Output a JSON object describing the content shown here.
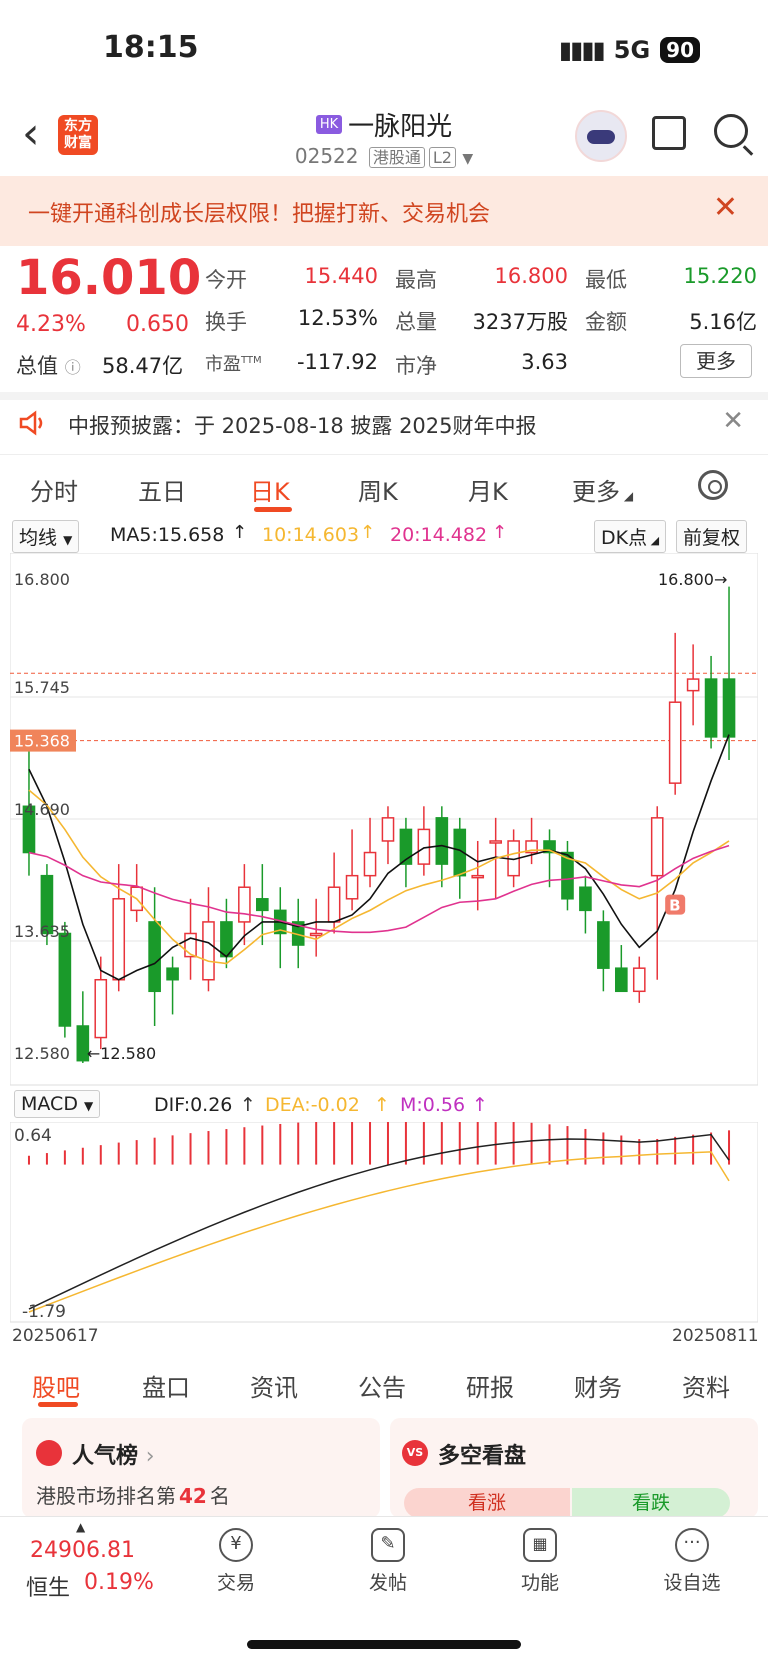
{
  "status_bar": {
    "time": "18:15",
    "network": "5G",
    "battery": "90"
  },
  "header": {
    "logo_text": "东方\n财富",
    "market_tag": "HK",
    "stock_name": "一脉阳光",
    "stock_code": "02522",
    "tag1": "港股通",
    "tag2": "L2"
  },
  "banner": {
    "text": "一键开通科创成长层权限！把握打新、交易机会"
  },
  "quote": {
    "price": "16.010",
    "change_pct": "4.23%",
    "change": "0.650",
    "mcap_label": "总值",
    "mcap": "58.47亿",
    "open_label": "今开",
    "open": "15.440",
    "high_label": "最高",
    "high": "16.800",
    "low_label": "最低",
    "low": "15.220",
    "turnover_label": "换手",
    "turnover": "12.53%",
    "volume_label": "总量",
    "volume": "3237万股",
    "amount_label": "金额",
    "amount": "5.16亿",
    "pe_label": "市盈",
    "pe_sup": "TTM",
    "pe": "-117.92",
    "pb_label": "市净",
    "pb": "3.63",
    "more_label": "更多"
  },
  "notice": {
    "text": "中报预披露：于 2025-08-18 披露 2025财年中报"
  },
  "chart_tabs": [
    "分时",
    "五日",
    "日K",
    "周K",
    "月K",
    "更多"
  ],
  "chart_tab_active": "日K",
  "ma_bar": {
    "selector": "均线",
    "ma5": "MA5:15.658",
    "ma10": "10:14.603",
    "ma20": "20:14.482",
    "dk_label": "DK点",
    "fq_label": "前复权"
  },
  "macd_bar": {
    "selector": "MACD",
    "dif": "DIF:0.26",
    "dea": "DEA:-0.02",
    "m": "M:0.56"
  },
  "colors": {
    "up": "#e8333a",
    "down": "#1a9a2a",
    "ma5": "#111111",
    "ma10": "#f5b731",
    "ma20": "#e0338f",
    "accent": "#f04a23"
  },
  "chart_data": [
    {
      "type": "candlestick",
      "title": "日K",
      "y_ticks": [
        "16.800",
        "15.745",
        "14.690",
        "13.635",
        "12.580"
      ],
      "ylim": [
        12.58,
        16.8
      ],
      "current_price_label": "15.368",
      "max_label": "16.800",
      "min_label": "12.580",
      "marker": "B",
      "start_date": "20250617",
      "end_date": "20250811",
      "candles": [
        [
          14.8,
          14.4,
          15.3,
          14.2
        ],
        [
          14.2,
          13.7,
          14.3,
          13.6
        ],
        [
          13.7,
          12.9,
          13.8,
          12.8
        ],
        [
          12.9,
          12.6,
          13.2,
          12.58
        ],
        [
          12.8,
          13.3,
          13.5,
          12.7
        ],
        [
          13.3,
          14.0,
          14.3,
          13.2
        ],
        [
          13.9,
          14.1,
          14.3,
          13.8
        ],
        [
          13.8,
          13.2,
          14.1,
          12.9
        ],
        [
          13.4,
          13.3,
          13.5,
          13.0
        ],
        [
          13.5,
          13.7,
          14.0,
          13.3
        ],
        [
          13.3,
          13.8,
          14.1,
          13.2
        ],
        [
          13.8,
          13.5,
          14.0,
          13.4
        ],
        [
          13.8,
          14.1,
          14.3,
          13.6
        ],
        [
          14.0,
          13.9,
          14.3,
          13.6
        ],
        [
          13.9,
          13.7,
          14.1,
          13.4
        ],
        [
          13.8,
          13.6,
          14.0,
          13.4
        ],
        [
          13.7,
          13.7,
          14.0,
          13.5
        ],
        [
          13.8,
          14.1,
          14.4,
          13.7
        ],
        [
          14.0,
          14.2,
          14.6,
          13.9
        ],
        [
          14.2,
          14.4,
          14.7,
          14.1
        ],
        [
          14.5,
          14.7,
          14.8,
          14.3
        ],
        [
          14.6,
          14.3,
          14.7,
          14.1
        ],
        [
          14.3,
          14.6,
          14.8,
          14.2
        ],
        [
          14.7,
          14.3,
          14.8,
          14.1
        ],
        [
          14.6,
          14.2,
          14.7,
          14.0
        ],
        [
          14.2,
          14.2,
          14.5,
          13.9
        ],
        [
          14.5,
          14.5,
          14.7,
          14.0
        ],
        [
          14.2,
          14.5,
          14.6,
          14.1
        ],
        [
          14.4,
          14.5,
          14.7,
          14.3
        ],
        [
          14.5,
          14.4,
          14.6,
          14.1
        ],
        [
          14.4,
          14.0,
          14.5,
          13.9
        ],
        [
          14.1,
          13.9,
          14.2,
          13.7
        ],
        [
          13.8,
          13.4,
          13.9,
          13.2
        ],
        [
          13.4,
          13.2,
          13.6,
          13.2
        ],
        [
          13.2,
          13.4,
          13.5,
          13.1
        ],
        [
          14.2,
          14.7,
          14.8,
          13.3
        ],
        [
          15.0,
          15.7,
          16.3,
          14.9
        ],
        [
          15.8,
          15.9,
          16.2,
          15.5
        ],
        [
          15.9,
          15.4,
          16.1,
          15.3
        ],
        [
          15.9,
          15.4,
          16.7,
          15.2
        ]
      ],
      "ma5_end": 15.658,
      "ma10_end": 14.603,
      "ma20_end": 14.482
    },
    {
      "type": "bar",
      "title": "MACD",
      "y_ticks": [
        "0.64",
        "-1.79"
      ],
      "ylim": [
        -1.79,
        0.64
      ],
      "dif": 0.26,
      "dea": -0.02,
      "m": 0.56
    }
  ],
  "section_tabs": [
    "股吧",
    "盘口",
    "资讯",
    "公告",
    "研报",
    "财务",
    "资料"
  ],
  "section_tab_active": "股吧",
  "cards": {
    "popularity_title": "人气榜",
    "popularity_sub_prefix": "港股市场排名第",
    "popularity_rank": "42",
    "popularity_sub_suffix": "名",
    "vs_title": "多空看盘",
    "vs_up": "看涨",
    "vs_down": "看跌"
  },
  "bottom_bar": {
    "index_value": "24906.81",
    "index_name": "恒生",
    "index_pct": "0.19%",
    "items": [
      "交易",
      "发帖",
      "功能",
      "设自选"
    ]
  }
}
